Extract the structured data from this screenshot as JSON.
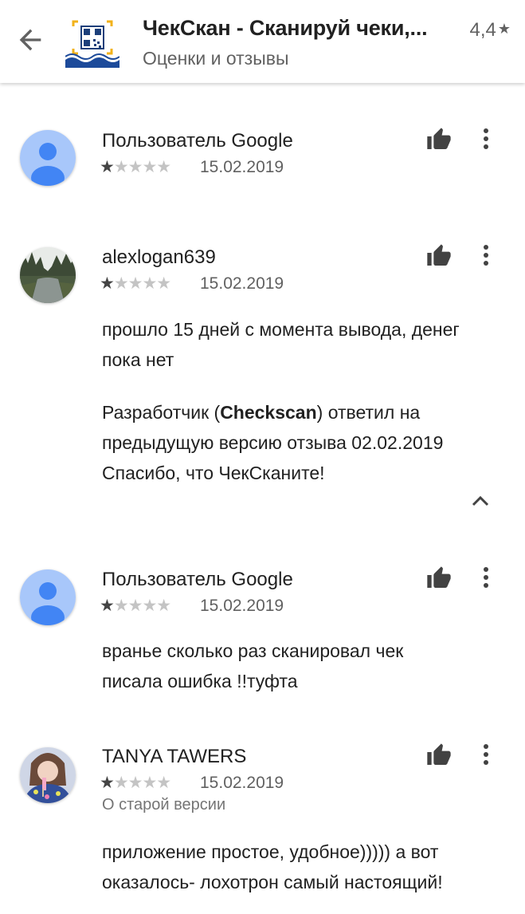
{
  "header": {
    "title": "ЧекСкан - Сканируй чеки,...",
    "subtitle": "Оценки и отзывы",
    "rating": "4,4",
    "rating_star": "★"
  },
  "reviews": [
    {
      "author": "Пользователь Google",
      "stars": 1,
      "date": "15.02.2019",
      "avatar": "default-person-avatar"
    },
    {
      "author": "alexlogan639",
      "stars": 1,
      "date": "15.02.2019",
      "avatar": "river-landscape-photo",
      "text": "прошло 15 дней с момента вывода, денег пока нет",
      "reply": {
        "prefix": "Разработчик (",
        "developer": "Checkscan",
        "suffix": ") ответил на предыдущую версию отзыва 02.02.2019",
        "text": "Спасибо, что ЧекСканите!"
      }
    },
    {
      "author": "Пользователь Google",
      "stars": 1,
      "date": "15.02.2019",
      "avatar": "default-person-avatar",
      "text": "вранье сколько раз сканировал чек писала ошибка !!туфта"
    },
    {
      "author": "TANYA TAWERS",
      "stars": 1,
      "date": "15.02.2019",
      "avatar": "girl-portrait-photo",
      "old_version": "О старой версии",
      "text": "приложение простое, удобное))))) а вот оказалось- лохотрон самый настоящий!"
    }
  ],
  "colors": {
    "avatar_bg": "#a8c7fa",
    "avatar_fg": "#4285f4",
    "star_on": "#444444",
    "star_off": "#c4c4c4",
    "icon": "#424242"
  }
}
